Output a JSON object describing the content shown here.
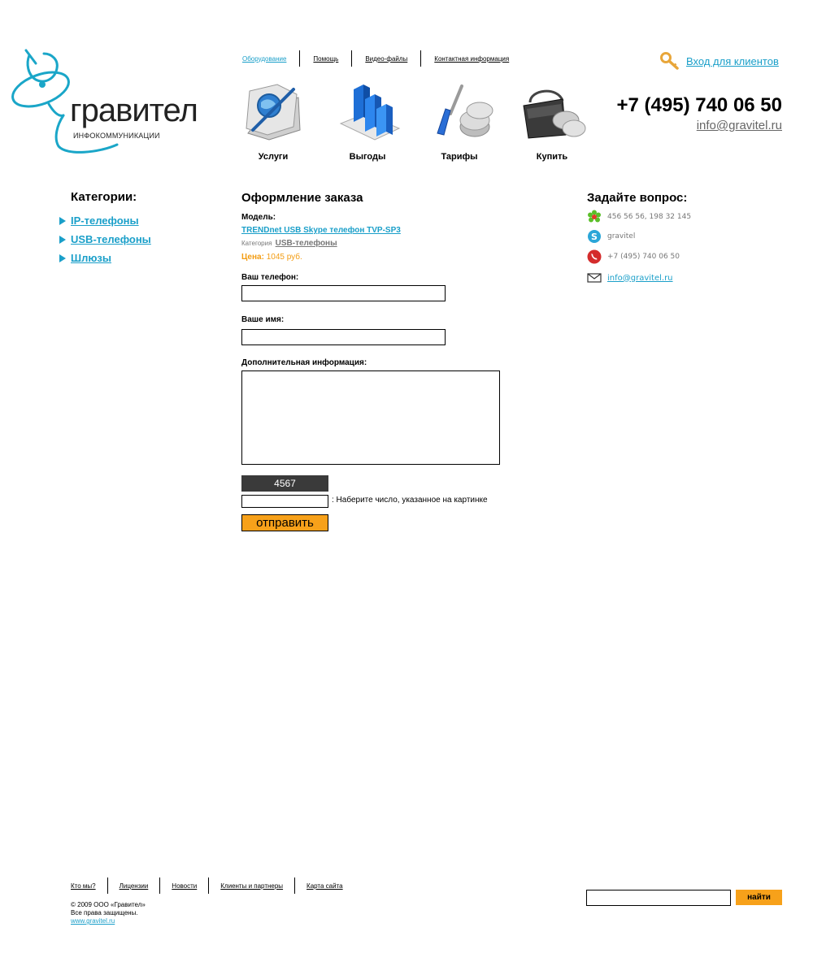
{
  "top_nav": [
    {
      "label": "Оборудование",
      "active": true
    },
    {
      "label": "Помощь",
      "active": false
    },
    {
      "label": "Видео-файлы",
      "active": false
    },
    {
      "label": "Контактная информация",
      "active": false
    }
  ],
  "logo": {
    "title": "гравител",
    "subtitle": "ИНФОКОММУНИКАЦИИ"
  },
  "big_menu": [
    {
      "label": "Услуги",
      "icon": "book-globe-icon"
    },
    {
      "label": "Выгоды",
      "icon": "bar-chart-icon"
    },
    {
      "label": "Тарифы",
      "icon": "screwdriver-coins-icon"
    },
    {
      "label": "Купить",
      "icon": "wallet-coins-icon"
    }
  ],
  "header": {
    "login_label": "Вход для клиентов",
    "phone": "+7 (495) 740 06 50",
    "email": "info@gravitel.ru"
  },
  "categories": {
    "title": "Категории:",
    "items": [
      "IP-телефоны",
      "USB-телефоны",
      "Шлюзы"
    ]
  },
  "order_form": {
    "title": "Оформление заказа",
    "model_label": "Модель:",
    "model_value": "TRENDnet USB Skype телефон TVP-SP3",
    "category_label": "Категория",
    "category_value": "USB-телефоны",
    "price_label": "Цена:",
    "price_value": "1045 руб.",
    "phone_label": "Ваш телефон:",
    "phone_value": "",
    "name_label": "Ваше имя:",
    "name_value": "",
    "extra_label": "Дополнительная информация:",
    "extra_value": "",
    "captcha_code": "4567",
    "captcha_value": "",
    "captcha_hint": ": Наберите число, указанное на картинке",
    "submit_label": "отправить"
  },
  "ask": {
    "title": "Задайте вопрос:",
    "icq": "456 56 56, 198 32 145",
    "skype": "gravitel",
    "phone": "+7 (495) 740 06 50",
    "email": "info@gravitel.ru"
  },
  "footer": {
    "nav": [
      "Кто мы?",
      "Лицензии",
      "Новости",
      "Клиенты и партнеры",
      "Карта сайта"
    ],
    "copyright": "© 2009 ООО «Гравител»",
    "rights": "Все права защищены.",
    "site": "www.gravitel.ru",
    "search_value": "",
    "search_button": "найти"
  },
  "colors": {
    "accent": "#1a9fc9",
    "button": "#f7a11a",
    "price": "#f39c12"
  }
}
